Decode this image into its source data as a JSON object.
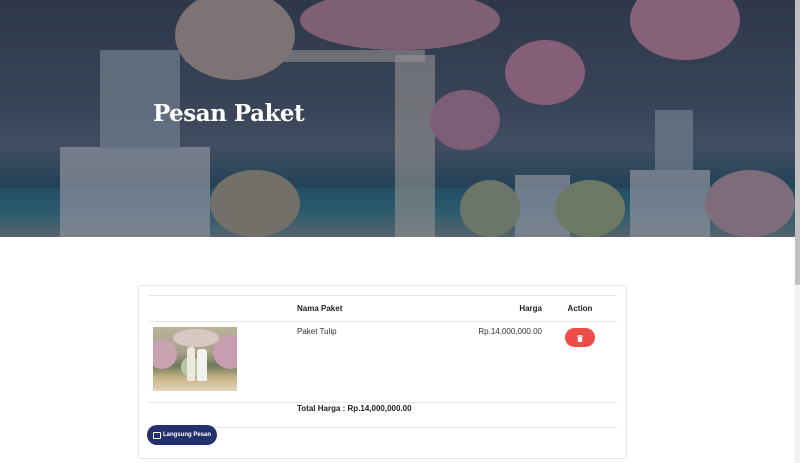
{
  "hero": {
    "title": "Pesan Paket"
  },
  "cart": {
    "columns": {
      "image": "",
      "name": "Nama Paket",
      "price": "Harga",
      "action": "Action"
    },
    "items": [
      {
        "name": "Paket Tulip",
        "price": "Rp.14,000,000.00",
        "image_icon": "wedding-photo"
      }
    ],
    "total_label": "Total Harga : Rp.14,000,000.00",
    "delete_icon": "trash-icon",
    "order_button": {
      "label": "Langsung Pesan",
      "icon": "check-square-icon"
    }
  },
  "colors": {
    "accent": "#23306d",
    "danger": "#f04c47"
  }
}
